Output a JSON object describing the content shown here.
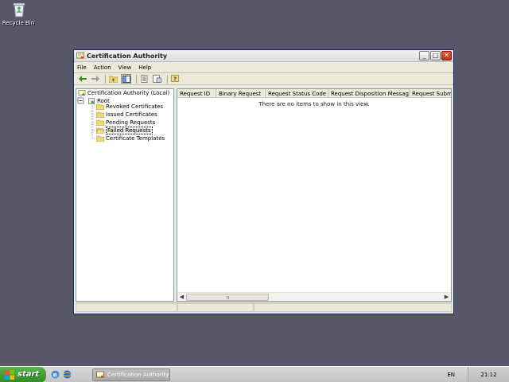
{
  "desktop": {
    "recycle_bin_label": "Recycle Bin"
  },
  "window": {
    "title": "Certification Authority",
    "buttons": {
      "minimize": "_",
      "maximize": "□",
      "close": "✕"
    }
  },
  "menu": {
    "file": "File",
    "action": "Action",
    "view": "View",
    "help": "Help"
  },
  "tree": {
    "root_label": "Certification Authority (Local)",
    "ca_label": "Root",
    "folders": [
      "Revoked Certificates",
      "Issued Certificates",
      "Pending Requests",
      "Failed Requests",
      "Certificate Templates"
    ],
    "selected": "Failed Requests"
  },
  "list": {
    "columns": [
      "Request ID",
      "Binary Request",
      "Request Status Code",
      "Request Disposition Message",
      "Request Submis"
    ],
    "empty_message": "There are no items to show in this view."
  },
  "taskbar": {
    "start_label": "start",
    "task_label": "Certification Authority",
    "language": "EN",
    "clock": "21:12"
  },
  "colors": {
    "desktop": "#575768",
    "window_face": "#ece9d8",
    "start_green": "#3a9a2f",
    "close_red": "#c8381c"
  }
}
